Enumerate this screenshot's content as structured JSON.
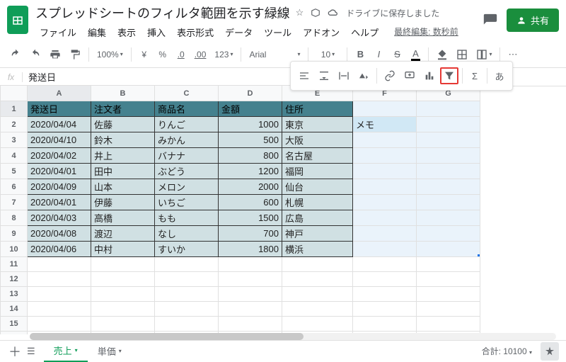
{
  "header": {
    "title": "スプレッドシートのフィルタ範囲を示す緑線",
    "drive_status": "ドライブに保存しました",
    "last_edit": "最終編集: 数秒前",
    "share": "共有"
  },
  "menus": [
    "ファイル",
    "編集",
    "表示",
    "挿入",
    "表示形式",
    "データ",
    "ツール",
    "アドオン",
    "ヘルプ"
  ],
  "toolbar": {
    "zoom": "100%",
    "currency_symbol": "¥",
    "percent": "%",
    "dec_dec": ".0",
    "dec_inc": ".00",
    "format_123": "123",
    "font": "Arial",
    "font_size": "10"
  },
  "formula_bar": {
    "label": "fx",
    "value": "発送日"
  },
  "columns": [
    "A",
    "B",
    "C",
    "D",
    "E",
    "F",
    "G"
  ],
  "data": {
    "headers": [
      "発送日",
      "注文者",
      "商品名",
      "金額",
      "住所"
    ],
    "rows": [
      [
        "2020/04/04",
        "佐藤",
        "りんご",
        "1000",
        "東京"
      ],
      [
        "2020/04/10",
        "鈴木",
        "みかん",
        "500",
        "大阪"
      ],
      [
        "2020/04/02",
        "井上",
        "バナナ",
        "800",
        "名古屋"
      ],
      [
        "2020/04/01",
        "田中",
        "ぶどう",
        "1200",
        "福岡"
      ],
      [
        "2020/04/09",
        "山本",
        "メロン",
        "2000",
        "仙台"
      ],
      [
        "2020/04/01",
        "伊藤",
        "いちご",
        "600",
        "札幌"
      ],
      [
        "2020/04/03",
        "高橋",
        "もも",
        "1500",
        "広島"
      ],
      [
        "2020/04/08",
        "渡辺",
        "なし",
        "700",
        "神戸"
      ],
      [
        "2020/04/06",
        "中村",
        "すいか",
        "1800",
        "横浜"
      ]
    ],
    "memo": "メモ"
  },
  "sheets": {
    "active": "売上",
    "others": [
      "単価"
    ]
  },
  "footer": {
    "sum_label": "合計:",
    "sum_value": "10100"
  },
  "floating_locale": "あ",
  "colors": {
    "accent": "#0f9d58",
    "header_bg": "#45818e",
    "cell_bg": "#d0e0e3"
  }
}
